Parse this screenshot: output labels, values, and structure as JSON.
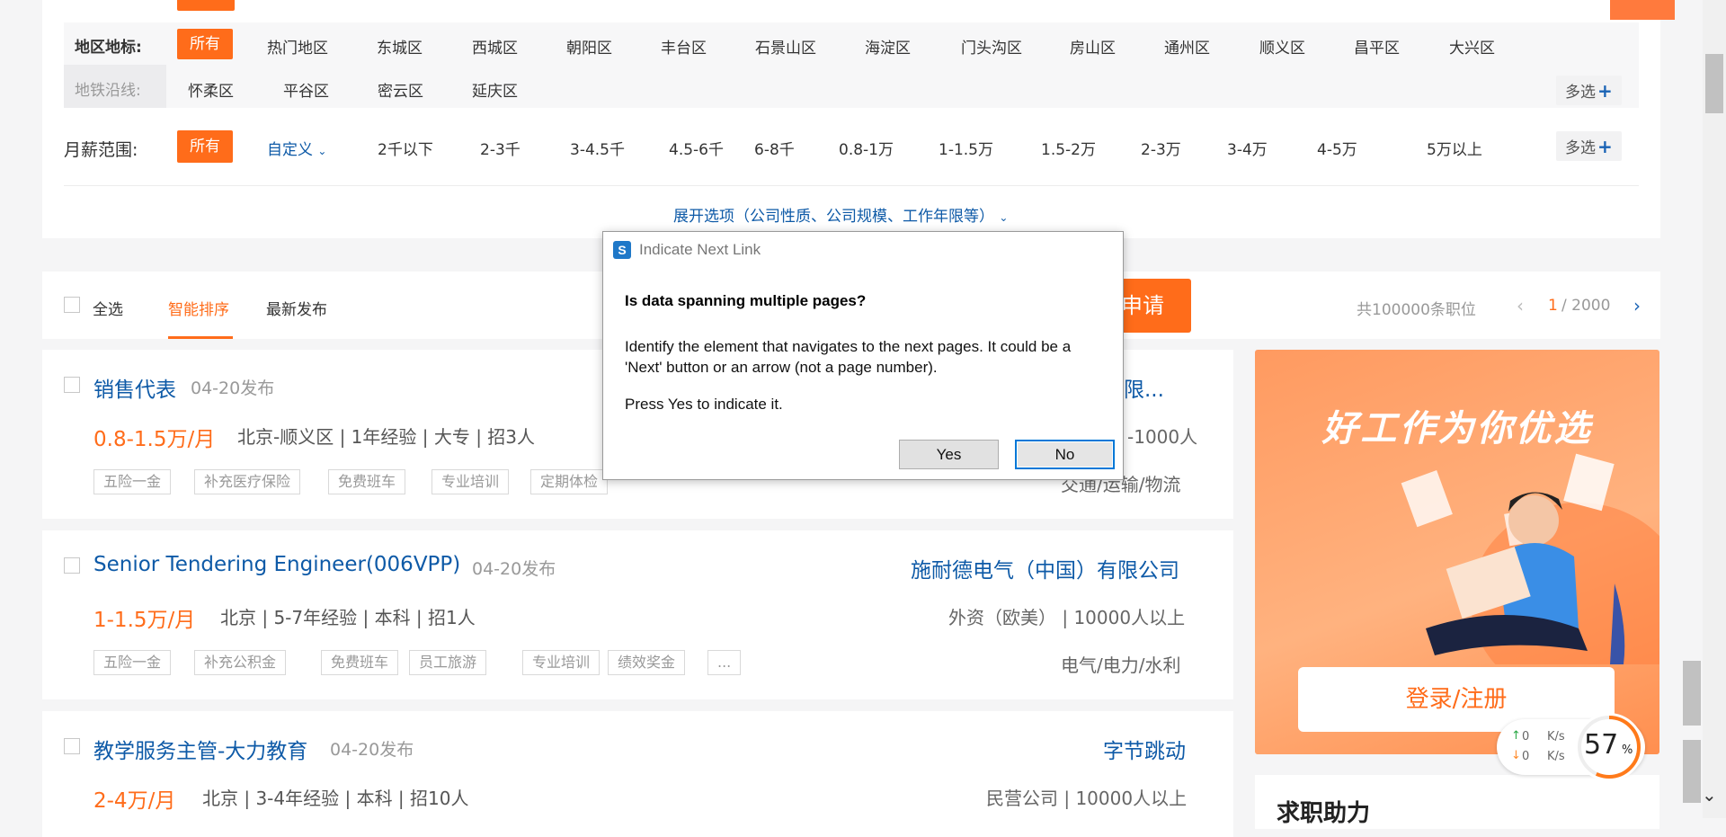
{
  "filters": {
    "area_label": "地区地标:",
    "metro_label": "地铁沿线:",
    "all": "所有",
    "districts_row1": [
      "热门地区",
      "东城区",
      "西城区",
      "朝阳区",
      "丰台区",
      "石景山区",
      "海淀区",
      "门头沟区",
      "房山区",
      "通州区",
      "顺义区",
      "昌平区",
      "大兴区"
    ],
    "districts_row2": [
      "怀柔区",
      "平谷区",
      "密云区",
      "延庆区"
    ],
    "multi": "多选",
    "salary_label": "月薪范围:",
    "custom": "自定义",
    "salary_ranges": [
      "2千以下",
      "2-3千",
      "3-4.5千",
      "4.5-6千",
      "6-8千",
      "0.8-1万",
      "1-1.5万",
      "1.5-2万",
      "2-3万",
      "3-4万",
      "4-5万",
      "5万以上"
    ],
    "expand": "展开选项（公司性质、公司规模、工作年限等）"
  },
  "sortbar": {
    "select_all": "全选",
    "smart_sort": "智能排序",
    "latest": "最新发布",
    "apply_partial": "申请",
    "total": "共100000条职位",
    "page_current": "1",
    "page_total": "/ 2000"
  },
  "jobs": [
    {
      "title": "销售代表",
      "date": "04-20发布",
      "salary": "0.8-1.5万/月",
      "meta": "北京-顺义区 | 1年经验 | 大专 | 招3人",
      "company": "有限...",
      "company_meta": "-1000人",
      "industry": "交通/运输/物流",
      "tags": [
        "五险一金",
        "补充医疗保险",
        "免费班车",
        "专业培训",
        "定期体检"
      ]
    },
    {
      "title": "Senior Tendering Engineer(006VPP)",
      "date": "04-20发布",
      "salary": "1-1.5万/月",
      "meta": "北京 | 5-7年经验 | 本科 | 招1人",
      "company": "施耐德电气（中国）有限公司",
      "company_meta": "外资（欧美） | 10000人以上",
      "industry": "电气/电力/水利",
      "tags": [
        "五险一金",
        "补充公积金",
        "免费班车",
        "员工旅游",
        "专业培训",
        "绩效奖金",
        "..."
      ]
    },
    {
      "title": "教学服务主管-大力教育",
      "date": "04-20发布",
      "salary": "2-4万/月",
      "meta": "北京 | 3-4年经验 | 本科 | 招10人",
      "company": "字节跳动",
      "company_meta": "民营公司 | 10000人以上"
    }
  ],
  "ad": {
    "title": "好工作为你优选",
    "login": "登录/注册"
  },
  "help": {
    "title": "求职助力"
  },
  "speed": {
    "up": "0",
    "down": "0",
    "unit": "K/s",
    "percent": "57",
    "percent_sign": "%"
  },
  "dialog": {
    "title": "Indicate Next Link",
    "heading": "Is data spanning multiple pages?",
    "body": "Identify the element that navigates to the next pages. It could be a 'Next' button or an arrow (not a page number).",
    "prompt": "Press Yes to indicate it.",
    "yes": "Yes",
    "no": "No"
  }
}
